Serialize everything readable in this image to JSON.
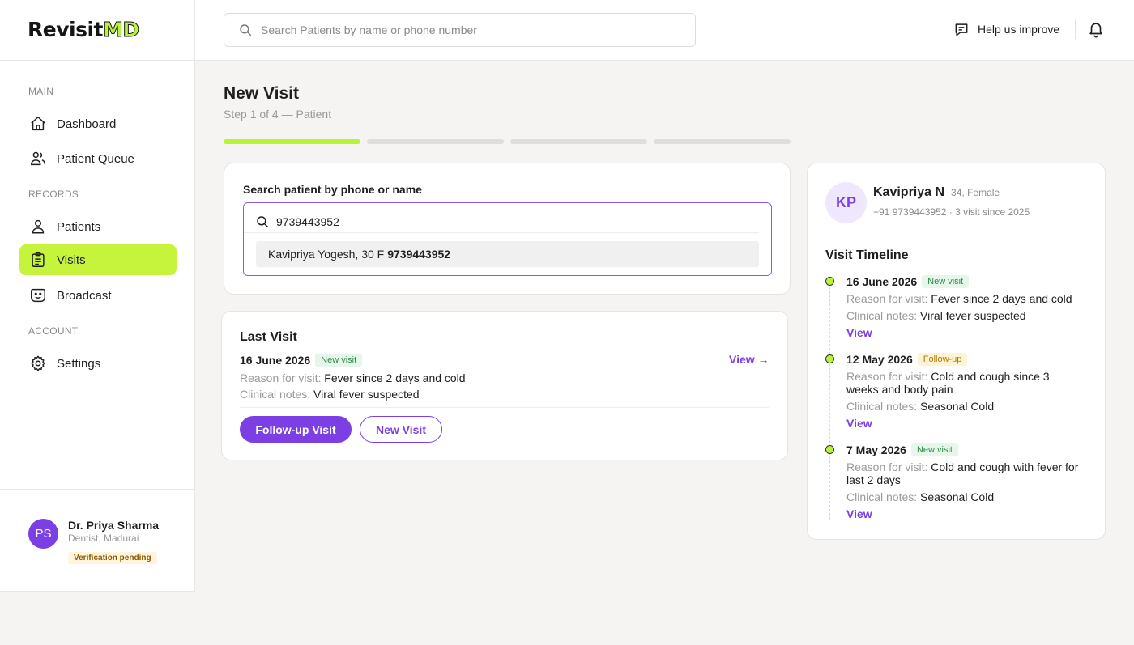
{
  "app": {
    "logo_main": "Revisit",
    "logo_accent": "MD"
  },
  "header": {
    "search_placeholder": "Search Patients by name or phone number",
    "help_label": "Help us improve"
  },
  "sidebar": {
    "sections": {
      "main": "MAIN",
      "records": "RECORDS",
      "account": "ACCOUNT"
    },
    "items": [
      {
        "label": "Dashboard",
        "icon": "home-icon"
      },
      {
        "label": "Patient Queue",
        "icon": "users-icon"
      },
      {
        "label": "Patients",
        "icon": "user-icon"
      },
      {
        "label": "Visits",
        "icon": "clipboard-icon",
        "active": true
      },
      {
        "label": "Broadcast",
        "icon": "smiley-icon"
      },
      {
        "label": "Settings",
        "icon": "gear-icon"
      }
    ],
    "user": {
      "initials": "PS",
      "name": "Dr. Priya Sharma",
      "role": "Dentist, Madurai",
      "status": "Verification pending"
    }
  },
  "page": {
    "title": "New Visit",
    "step": "Step 1 of 4 — Patient",
    "progress": {
      "current_step": 1,
      "total_steps": 4
    }
  },
  "patient_search": {
    "label": "Search patient by phone or name",
    "value": "9739443952",
    "suggestion": {
      "text": "Kavipriya Yogesh, 30 F",
      "phone": "9739443952"
    }
  },
  "last_visit": {
    "title": "Last Visit",
    "date": "16 June 2026",
    "badge": "New visit",
    "reason_label": "Reason for visit:",
    "reason": "Fever since 2 days and cold",
    "notes_label": "Clinical notes:",
    "notes": "Viral fever suspected",
    "view_label": "View →",
    "followup_button": "Follow-up Visit",
    "new_visit_button": "New Visit"
  },
  "patient": {
    "initials": "KP",
    "name": "Kavipriya N",
    "meta": "34, Female",
    "contact": "+91 9739443952 · 3 visit since 2025"
  },
  "timeline": {
    "title": "Visit Timeline",
    "reason_label": "Reason for visit:",
    "notes_label": "Clinical notes:",
    "view_label": "View",
    "entries": [
      {
        "date": "16 June 2026",
        "badge": "New visit",
        "reason": "Fever since 2 days and cold",
        "notes": "Viral fever suspected"
      },
      {
        "date": "12 May 2026",
        "badge": "Follow-up",
        "reason": "Cold and cough since 3 weeks and body pain",
        "notes": "Seasonal Cold"
      },
      {
        "date": "7 May 2026",
        "badge": "New visit",
        "reason": "Cold and cough with fever for last 2 days",
        "notes": "Seasonal Cold"
      }
    ]
  },
  "colors": {
    "accent_lime": "#b8f33a",
    "primary_purple": "#7b3fe4"
  }
}
